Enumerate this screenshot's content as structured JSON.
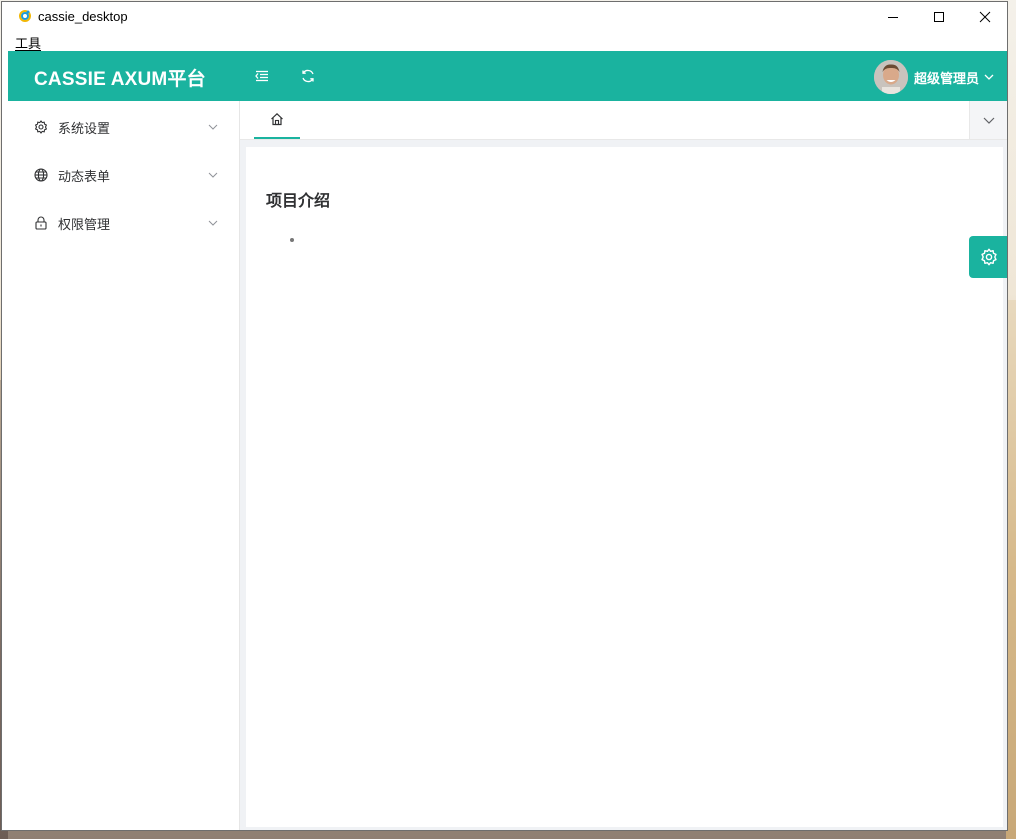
{
  "window": {
    "title": "cassie_desktop",
    "menu": [
      "工具"
    ]
  },
  "header": {
    "brand": "CASSIE AXUM平台",
    "user_name": "超级管理员",
    "accent_color": "#1ab39f"
  },
  "sidebar": {
    "items": [
      {
        "label": "系统设置",
        "icon": "gear-icon"
      },
      {
        "label": "动态表单",
        "icon": "globe-icon"
      },
      {
        "label": "权限管理",
        "icon": "lock-icon"
      }
    ]
  },
  "tabs": [
    {
      "icon": "home-icon",
      "active": true
    }
  ],
  "content": {
    "title": "项目介绍"
  }
}
